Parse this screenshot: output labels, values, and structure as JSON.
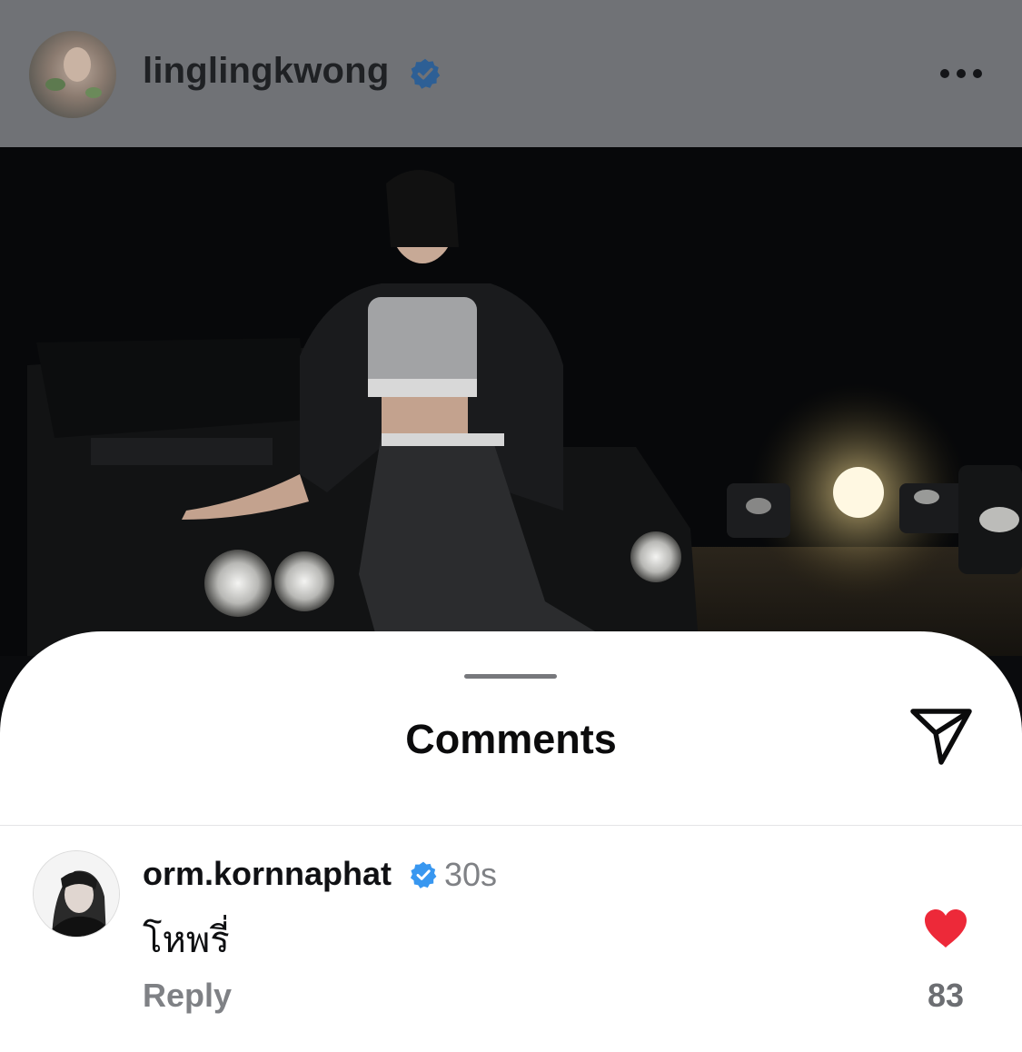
{
  "post": {
    "username": "linglingkwong",
    "verified_icon": "verified-badge-icon",
    "more_icon": "more-horizontal-icon"
  },
  "comments_sheet": {
    "title": "Comments",
    "share_icon": "send-paper-plane-icon",
    "comments": [
      {
        "username": "orm.kornnaphat",
        "verified": true,
        "time": "30s",
        "text": "โหพรี่",
        "reply_label": "Reply",
        "liked": true,
        "likes": "83"
      }
    ]
  },
  "colors": {
    "header_dim": "#707276",
    "verified_blue": "#3897f0",
    "heart_red": "#ed2939",
    "muted_text": "#7f8185"
  }
}
